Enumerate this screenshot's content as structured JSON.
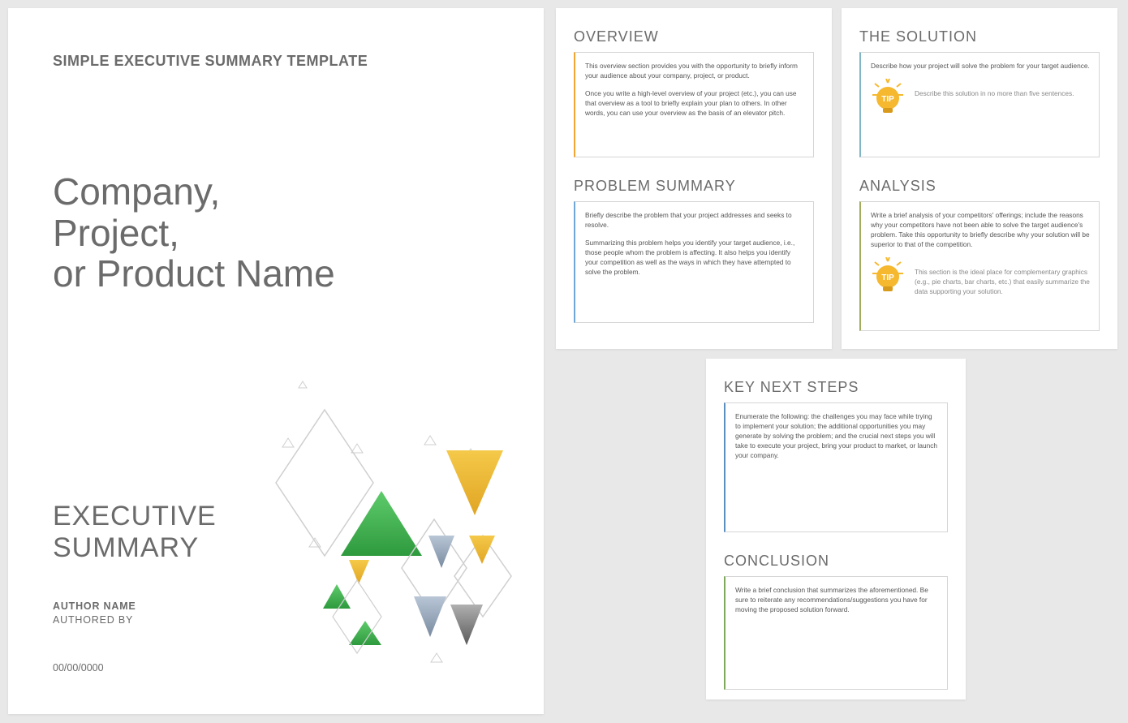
{
  "cover": {
    "header": "SIMPLE EXECUTIVE SUMMARY TEMPLATE",
    "title_line1": "Company,",
    "title_line2": "Project,",
    "title_line3": "or Product Name",
    "exec_line1": "EXECUTIVE",
    "exec_line2": "SUMMARY",
    "author_name": "AUTHOR NAME",
    "authored_by": "AUTHORED BY",
    "date": "00/00/0000"
  },
  "overview": {
    "title": "OVERVIEW",
    "p1": "This overview section provides you with the opportunity to briefly inform your audience about your company, project, or product.",
    "p2": "Once you write a high-level overview of your project (etc.), you can use that overview as a tool to briefly explain your plan to others. In other words, you can use your overview as the basis of an elevator pitch."
  },
  "problem": {
    "title": "PROBLEM SUMMARY",
    "p1": "Briefly describe the problem that your project addresses and seeks to resolve.",
    "p2": "Summarizing this problem helps you identify your target audience, i.e., those people whom the problem is affecting. It also helps you identify your competition as well as the ways in which they have attempted to solve the problem."
  },
  "solution": {
    "title": "THE SOLUTION",
    "p1": "Describe how your project will solve the problem for your target audience.",
    "tip": "Describe this solution in no more than five sentences."
  },
  "analysis": {
    "title": "ANALYSIS",
    "p1": "Write a brief analysis of your competitors' offerings; include the reasons why your competitors have not been able to solve the target audience's problem. Take this opportunity to briefly describe why your solution will be superior to that of the competition.",
    "tip": "This section is the ideal place for complementary graphics (e.g., pie charts, bar charts, etc.) that easily summarize the data supporting your solution."
  },
  "keynext": {
    "title": "KEY NEXT STEPS",
    "p1": "Enumerate the following: the challenges you may face while trying to implement your solution; the additional opportunities you may generate by solving the problem; and the crucial next steps you will take to execute your project, bring your product to market, or launch your company."
  },
  "conclusion": {
    "title": "CONCLUSION",
    "p1": "Write a brief conclusion that summarizes the aforementioned. Be sure to reiterate any recommendations/suggestions you have for moving the proposed solution forward."
  }
}
